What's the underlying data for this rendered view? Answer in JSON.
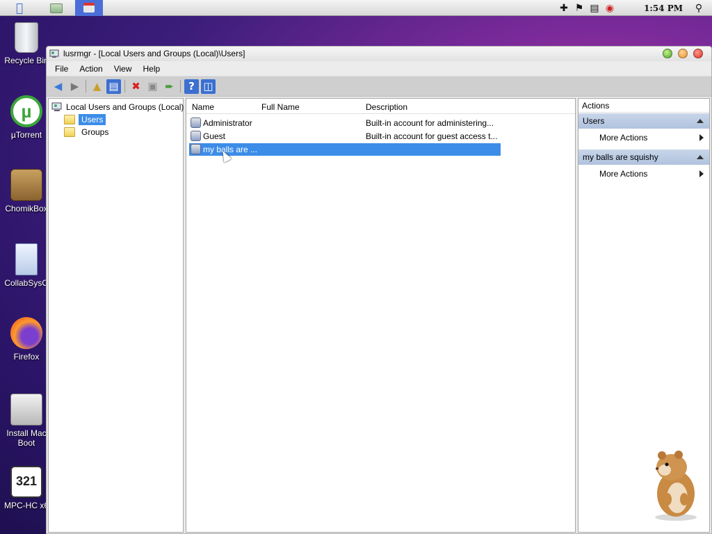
{
  "menubar": {
    "clock": "1:54 PM",
    "tray_icons": [
      "add-icon",
      "flag-icon",
      "network-icon",
      "volume-muted-icon",
      "search-icon"
    ]
  },
  "desktop_icons": [
    {
      "label": "Recycle Bin",
      "icon": "recycle-bin-icon"
    },
    {
      "label": "µTorrent",
      "icon": "utorrent-icon"
    },
    {
      "label": "ChomikBox",
      "icon": "chomikbox-icon"
    },
    {
      "label": "CollabSysO",
      "icon": "document-icon"
    },
    {
      "label": "Firefox",
      "icon": "firefox-icon"
    },
    {
      "label": "Install Mac",
      "label2": "Boot",
      "icon": "installer-icon"
    },
    {
      "label": "MPC-HC x6",
      "icon": "media-player-icon"
    }
  ],
  "window": {
    "title": "lusrmgr - [Local Users and Groups (Local)\\Users]",
    "menu": [
      "File",
      "Action",
      "View",
      "Help"
    ]
  },
  "tree": {
    "root": "Local Users and Groups (Local)",
    "items": [
      {
        "label": "Users",
        "selected": true
      },
      {
        "label": "Groups",
        "selected": false
      }
    ]
  },
  "list": {
    "columns": [
      "Name",
      "Full Name",
      "Description"
    ],
    "rows": [
      {
        "name": "Administrator",
        "full_name": "",
        "description": "Built-in account for administering..."
      },
      {
        "name": "Guest",
        "full_name": "",
        "description": "Built-in account for guest access t..."
      },
      {
        "name": "my balls are ...",
        "full_name": "",
        "description": "",
        "selected": true
      }
    ]
  },
  "actions": {
    "header": "Actions",
    "groups": [
      {
        "title": "Users",
        "items": [
          "More Actions"
        ]
      },
      {
        "title": "my balls are squishy",
        "items": [
          "More Actions"
        ]
      }
    ]
  },
  "colors": {
    "selection": "#3c8de8",
    "action_group_bg": "#b8c8e2",
    "toolbar_pressed": "#3c6fd0"
  }
}
